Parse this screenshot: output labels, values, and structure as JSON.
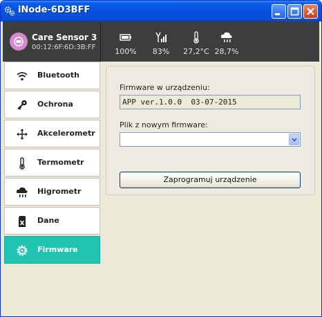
{
  "window": {
    "title": "iNode-6D3BFF"
  },
  "device": {
    "name": "Care Sensor 3",
    "mac": "00:12:6F:6D:3B:FF"
  },
  "stats": [
    {
      "icon": "battery-icon",
      "value": "100%"
    },
    {
      "icon": "signal-antenna-icon",
      "value": "83%"
    },
    {
      "icon": "thermometer-icon",
      "value": "27,2°C"
    },
    {
      "icon": "cloud-rain-icon",
      "value": "28,7%"
    }
  ],
  "sidebar": {
    "items": [
      {
        "label": "Bluetooth",
        "icon": "wifi-icon",
        "active": false
      },
      {
        "label": "Ochrona",
        "icon": "key-icon",
        "active": false
      },
      {
        "label": "Akcelerometr",
        "icon": "move-arrows-icon",
        "active": false
      },
      {
        "label": "Termometr",
        "icon": "thermometer-icon",
        "active": false
      },
      {
        "label": "Higrometr",
        "icon": "cloud-rain-icon",
        "active": false
      },
      {
        "label": "Dane",
        "icon": "sd-card-icon",
        "active": false
      },
      {
        "label": "Firmware",
        "icon": "gear-icon",
        "active": true
      }
    ]
  },
  "firmware": {
    "current_label": "Firmware w urządzeniu:",
    "current_value": "APP ver.1.0.0  03-07-2015",
    "file_label": "Plik z nowym firmware:",
    "file_value": "",
    "program_button": "Zaprogramuj urządzenie"
  },
  "colors": {
    "active_nav": "#20c4b0",
    "header_bg": "#3d3d3d",
    "titlebar": "#0552e0"
  }
}
